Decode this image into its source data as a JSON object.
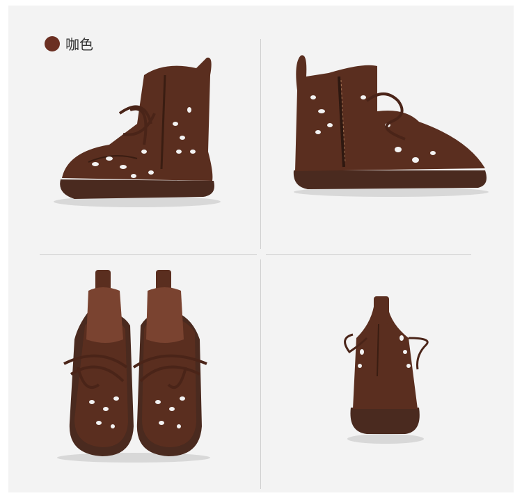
{
  "color_label": {
    "text": "咖色",
    "swatch_color": "#6b2f22"
  },
  "colors": {
    "leather": "#5a2e1f",
    "leather_light": "#7a4330",
    "sole": "#4a2a1f",
    "background": "#f3f3f3"
  },
  "views": [
    {
      "name": "side-view-left",
      "icon": "boot-side-left"
    },
    {
      "name": "side-view-right",
      "icon": "boot-side-right"
    },
    {
      "name": "top-view-pair",
      "icon": "boot-pair-top"
    },
    {
      "name": "back-view",
      "icon": "boot-back"
    }
  ]
}
